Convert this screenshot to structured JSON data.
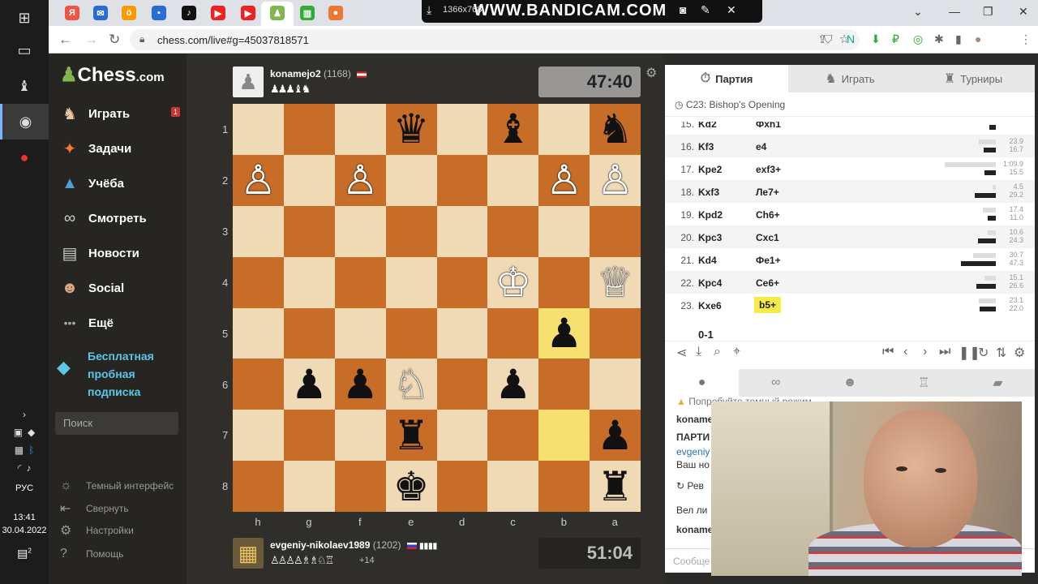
{
  "taskbar": {
    "tray_lang": "РУС",
    "time": "13:41",
    "date": "30.04.2022",
    "notif_count": "2"
  },
  "bandicam": {
    "resolution": "1366x768",
    "brand": "WWW.BANDICAM.COM"
  },
  "browser": {
    "url": "chess.com/live#g=45037818571"
  },
  "sidebar": {
    "logo": "Chess",
    "logo_suffix": ".com",
    "items": [
      {
        "label": "Играть",
        "badge": "1"
      },
      {
        "label": "Задачи"
      },
      {
        "label": "Учёба"
      },
      {
        "label": "Смотреть"
      },
      {
        "label": "Новости"
      },
      {
        "label": "Social"
      },
      {
        "label": "Ещё"
      }
    ],
    "promo": "Бесплатная пробная подписка",
    "search_placeholder": "Поиск",
    "footer": [
      {
        "label": "Темный интерфейс"
      },
      {
        "label": "Свернуть"
      },
      {
        "label": "Настройки"
      },
      {
        "label": "Помощь"
      }
    ]
  },
  "top_player": {
    "name": "konamejo2",
    "rating": "(1168)",
    "captured": "♟♟♟♝♞",
    "clock": "47:40"
  },
  "bottom_player": {
    "name": "evgeniy-nikolaev1989",
    "rating": "(1202)",
    "captured": "♙♙♙♙♗♗♘♖",
    "diff": "+14",
    "clock": "51:04"
  },
  "board": {
    "ranks": [
      "1",
      "2",
      "3",
      "4",
      "5",
      "6",
      "7",
      "8"
    ],
    "files": [
      "h",
      "g",
      "f",
      "e",
      "d",
      "c",
      "b",
      "a"
    ],
    "pieces": [
      [
        "",
        "",
        "",
        "♛",
        "",
        "♝",
        "",
        "♞"
      ],
      [
        "♙",
        "",
        "♙",
        "",
        "",
        "",
        "♙",
        "♙"
      ],
      [
        "",
        "",
        "",
        "",
        "",
        "",
        "",
        ""
      ],
      [
        "",
        "",
        "",
        "",
        "",
        "♔",
        "",
        "♕"
      ],
      [
        "",
        "",
        "",
        "",
        "",
        "",
        "♟",
        ""
      ],
      [
        "",
        "♟",
        "♟",
        "♘",
        "",
        "♟",
        "",
        ""
      ],
      [
        "",
        "",
        "",
        "♜",
        "",
        "",
        "",
        "♟"
      ],
      [
        "",
        "",
        "",
        "♚",
        "",
        "",
        "",
        "♜"
      ]
    ],
    "piece_colors": [
      [
        "",
        "",
        "",
        "b",
        "",
        "b",
        "",
        "b"
      ],
      [
        "w",
        "",
        "w",
        "",
        "",
        "",
        "w",
        "w"
      ],
      [
        "",
        "",
        "",
        "",
        "",
        "",
        "",
        ""
      ],
      [
        "",
        "",
        "",
        "",
        "",
        "w",
        "",
        "w"
      ],
      [
        "",
        "",
        "",
        "",
        "",
        "",
        "b",
        ""
      ],
      [
        "",
        "b",
        "b",
        "w",
        "",
        "b",
        "",
        ""
      ],
      [
        "",
        "",
        "",
        "b",
        "",
        "",
        "",
        "b"
      ],
      [
        "",
        "",
        "",
        "b",
        "",
        "",
        "",
        "b"
      ]
    ],
    "highlights": [
      [
        4,
        6
      ],
      [
        6,
        6
      ]
    ]
  },
  "right_panel": {
    "tabs": [
      "Партия",
      "Играть",
      "Турниры"
    ],
    "opening": "C23: Bishop's Opening",
    "moves": [
      {
        "n": "15.",
        "w": "Kd2",
        "b": "Фxh1",
        "t1": "",
        "t2": "8.7"
      },
      {
        "n": "16.",
        "w": "Kf3",
        "b": "e4",
        "t1": "23.9",
        "t2": "16.7"
      },
      {
        "n": "17.",
        "w": "Kpe2",
        "b": "exf3+",
        "t1": "1:09.9",
        "t2": "15.5"
      },
      {
        "n": "18.",
        "w": "Kxf3",
        "b": "Ле7+",
        "t1": "4.5",
        "t2": "29.2"
      },
      {
        "n": "19.",
        "w": "Kpd2",
        "b": "Сh6+",
        "t1": "17.4",
        "t2": "11.0"
      },
      {
        "n": "20.",
        "w": "Kpc3",
        "b": "Cxc1",
        "t1": "10.6",
        "t2": "24.3"
      },
      {
        "n": "21.",
        "w": "Kd4",
        "b": "Фе1+",
        "t1": "30.7",
        "t2": "47.3"
      },
      {
        "n": "22.",
        "w": "Kpc4",
        "b": "Се6+",
        "t1": "15.1",
        "t2": "26.6"
      },
      {
        "n": "23.",
        "w": "Kxe6",
        "b": "b5+",
        "t1": "23.1",
        "t2": "22.0"
      }
    ],
    "result": "0-1",
    "chat_lines": [
      "Попробуйте темный режим",
      "koname",
      "ПАРТИ",
      "evgeniy",
      "Ваш но",
      "Рев",
      "Вел ли",
      "koname"
    ],
    "chat_placeholder": "Сообще"
  }
}
